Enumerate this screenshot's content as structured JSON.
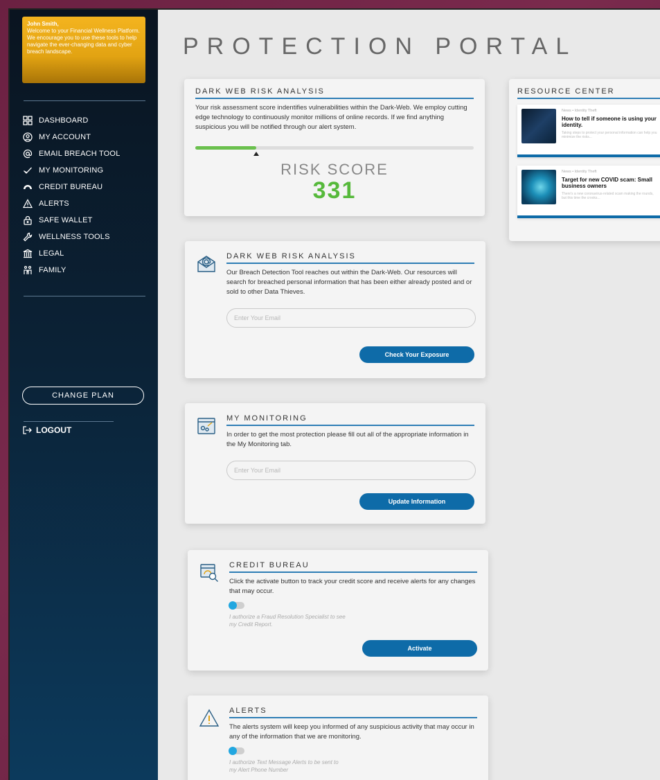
{
  "sidebar": {
    "welcome_name": "John Smith,",
    "welcome_text": "Welcome to your Financial Wellness Platform. We encourage you to use these tools to help navigate the ever-changing data and cyber breach landscape.",
    "items": [
      {
        "label": "DASHBOARD",
        "icon": "dashboard-icon"
      },
      {
        "label": "MY ACCOUNT",
        "icon": "user-icon"
      },
      {
        "label": "EMAIL BREACH TOOL",
        "icon": "at-icon"
      },
      {
        "label": "MY MONITORING",
        "icon": "check-icon"
      },
      {
        "label": "CREDIT BUREAU",
        "icon": "gauge-icon"
      },
      {
        "label": "ALERTS",
        "icon": "warning-icon"
      },
      {
        "label": "SAFE WALLET",
        "icon": "lock-icon"
      },
      {
        "label": "WELLNESS TOOLS",
        "icon": "wrench-icon"
      },
      {
        "label": "LEGAL",
        "icon": "courthouse-icon"
      },
      {
        "label": "FAMILY",
        "icon": "family-icon"
      }
    ],
    "change_plan": "CHANGE PLAN",
    "logout": "LOGOUT"
  },
  "main": {
    "title": "PROTECTION PORTAL",
    "risk": {
      "heading": "DARK WEB RISK ANALYSIS",
      "text": "Your risk assessment score indentifies vulnerabilities within the Dark-Web. We employ cutting edge technology to continuously monitor millions of online records. If we find anything suspicious you will be notified through our alert system.",
      "progress_fraction": 0.22,
      "score_label": "RISK SCORE",
      "score": "331"
    },
    "breach": {
      "heading": "DARK WEB RISK ANALYSIS",
      "text": "Our Breach Detection Tool reaches out within the Dark-Web. Our resources will search for breached personal information that has been either already posted and or sold to other Data Thieves.",
      "placeholder": "Enter Your Email",
      "button": "Check Your Exposure"
    },
    "monitoring": {
      "heading": "MY MONITORING",
      "text": "In order to get the most protection please fill out all of the appropriate information in the My Monitoring tab.",
      "placeholder": "Enter Your Email",
      "button": "Update Information"
    },
    "credit": {
      "heading": "CREDIT BUREAU",
      "text": "Click the activate button to track your credit score and receive alerts for any changes that may occur.",
      "consent": "I authorize a Fraud Resolution Specialist to see my Credit Report.",
      "button": "Activate"
    },
    "alerts": {
      "heading": "ALERTS",
      "text": "The alerts system will keep you informed of any suspicious activity that may occur in any of the information that we are monitoring.",
      "consent": "I authorize Text Message Alerts to be sent to my Alert Phone Number"
    }
  },
  "resources": {
    "heading": "RESOURCE CENTER",
    "items": [
      {
        "meta": "News • Identity Theft",
        "title": "How to tell if someone is using your identity.",
        "desc": "Taking steps to protect your personal information can help you minimize the risks..."
      },
      {
        "meta": "News • Identity Theft",
        "title": "Target for new COVID scam: Small business owners",
        "desc": "There's a new coronavirus-related scam making the rounds, but this time the crooks..."
      }
    ]
  },
  "colors": {
    "accent": "#0e6ba8",
    "score": "#56b93b",
    "welcome": "#f4b41f"
  }
}
